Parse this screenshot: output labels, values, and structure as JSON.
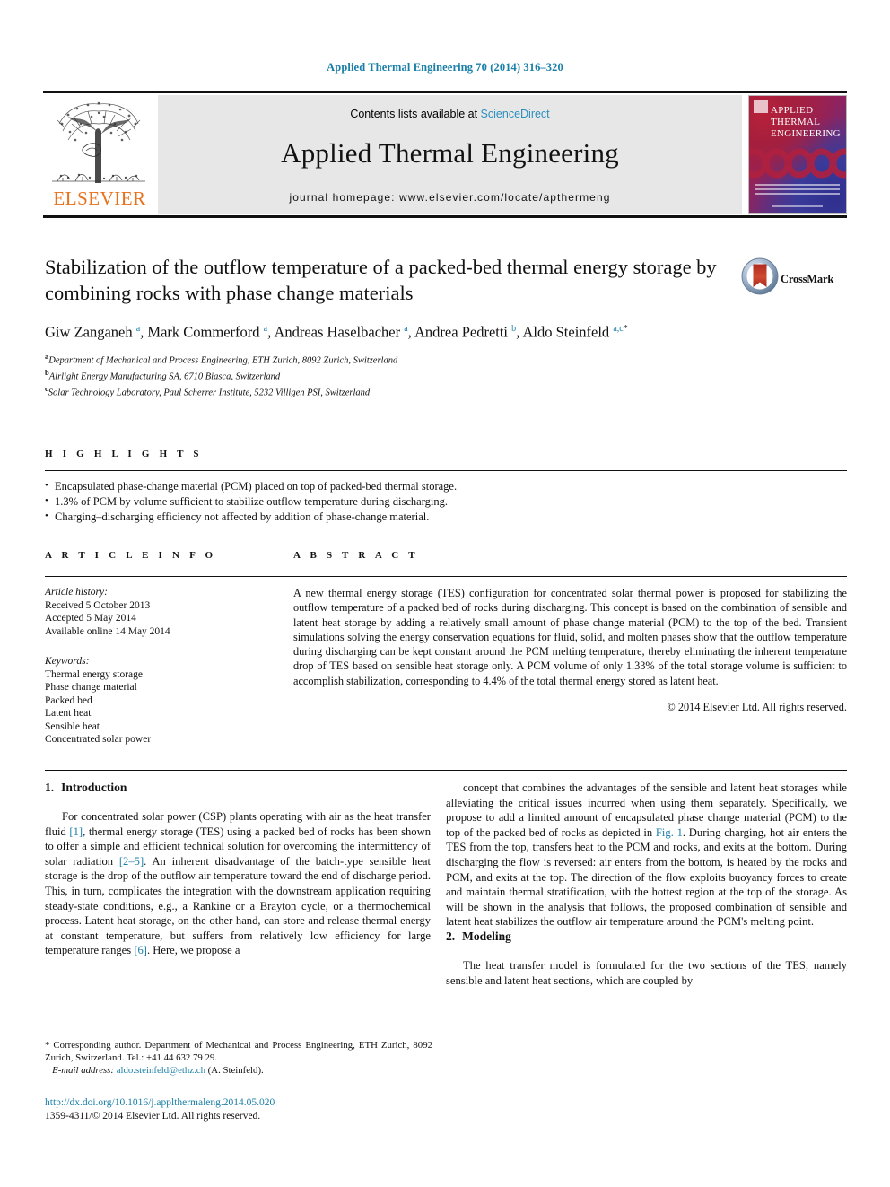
{
  "running_head": "Applied Thermal Engineering 70 (2014) 316–320",
  "masthead": {
    "publisher_name": "ELSEVIER",
    "contents_prefix": "Contents lists available at ",
    "contents_link": "ScienceDirect",
    "journal_title": "Applied Thermal Engineering",
    "homepage": "journal homepage: www.elsevier.com/locate/apthermeng",
    "cover_title": "APPLIED THERMAL ENGINEERING"
  },
  "crossmark": {
    "label": "CrossMark"
  },
  "article": {
    "title": "Stabilization of the outflow temperature of a packed-bed thermal energy storage by combining rocks with phase change materials",
    "authors_html": "Giw Zanganeh <sup>a</sup>, Mark Commerford <sup>a</sup>, Andreas Haselbacher <sup>a</sup>, Andrea Pedretti <sup>b</sup>, Aldo Steinfeld <sup>a,c</sup><sup class=\"star\">*</sup>",
    "affiliations": [
      {
        "marker": "a",
        "text": "Department of Mechanical and Process Engineering, ETH Zurich, 8092 Zurich, Switzerland"
      },
      {
        "marker": "b",
        "text": "Airlight Energy Manufacturing SA, 6710 Biasca, Switzerland"
      },
      {
        "marker": "c",
        "text": "Solar Technology Laboratory, Paul Scherrer Institute, 5232 Villigen PSI, Switzerland"
      }
    ]
  },
  "highlights": {
    "heading": "H I G H L I G H T S",
    "items": [
      "Encapsulated phase-change material (PCM) placed on top of packed-bed thermal storage.",
      "1.3% of PCM by volume sufficient to stabilize outflow temperature during discharging.",
      "Charging–discharging efficiency not affected by addition of phase-change material."
    ]
  },
  "article_info": {
    "heading": "A R T I C L E   I N F O",
    "history_label": "Article history:",
    "history": [
      "Received 5 October 2013",
      "Accepted 5 May 2014",
      "Available online 14 May 2014"
    ],
    "keywords_label": "Keywords:",
    "keywords": [
      "Thermal energy storage",
      "Phase change material",
      "Packed bed",
      "Latent heat",
      "Sensible heat",
      "Concentrated solar power"
    ]
  },
  "abstract": {
    "heading": "A B S T R A C T",
    "text": "A new thermal energy storage (TES) configuration for concentrated solar thermal power is proposed for stabilizing the outflow temperature of a packed bed of rocks during discharging. This concept is based on the combination of sensible and latent heat storage by adding a relatively small amount of phase change material (PCM) to the top of the bed. Transient simulations solving the energy conservation equations for fluid, solid, and molten phases show that the outflow temperature during discharging can be kept constant around the PCM melting temperature, thereby eliminating the inherent temperature drop of TES based on sensible heat storage only. A PCM volume of only 1.33% of the total storage volume is sufficient to accomplish stabilization, corresponding to 4.4% of the total thermal energy stored as latent heat.",
    "copyright": "© 2014 Elsevier Ltd. All rights reserved."
  },
  "body": {
    "section1": {
      "number": "1.",
      "title": "Introduction",
      "paragraph_html": "For concentrated solar power (CSP) plants operating with air as the heat transfer fluid <span class=\"ref\">[1]</span>, thermal energy storage (TES) using a packed bed of rocks has been shown to offer a simple and efficient technical solution for overcoming the intermittency of solar radiation <span class=\"ref\">[2–5]</span>. An inherent disadvantage of the batch-type sensible heat storage is the drop of the outflow air temperature toward the end of discharge period. This, in turn, complicates the integration with the downstream application requiring steady-state conditions, e.g., a Rankine or a Brayton cycle, or a thermochemical process. Latent heat storage, on the other hand, can store and release thermal energy at constant temperature, but suffers from relatively low efficiency for large temperature ranges <span class=\"ref\">[6]</span>. Here, we propose a"
    },
    "section1_cont": {
      "paragraph_html": "concept that combines the advantages of the sensible and latent heat storages while alleviating the critical issues incurred when using them separately. Specifically, we propose to add a limited amount of encapsulated phase change material (PCM) to the top of the packed bed of rocks as depicted in <span class=\"ref\">Fig. 1</span>. During charging, hot air enters the TES from the top, transfers heat to the PCM and rocks, and exits at the bottom. During discharging the flow is reversed: air enters from the bottom, is heated by the rocks and PCM, and exits at the top. The direction of the flow exploits buoyancy forces to create and maintain thermal stratification, with the hottest region at the top of the storage. As will be shown in the analysis that follows, the proposed combination of sensible and latent heat stabilizes the outflow air temperature around the PCM's melting point."
    },
    "section2": {
      "number": "2.",
      "title": "Modeling",
      "paragraph_html": "The heat transfer model is formulated for the two sections of the TES, namely sensible and latent heat sections, which are coupled by"
    }
  },
  "footnote": {
    "corresponding_html": "* Corresponding author. Department of Mechanical and Process Engineering, ETH Zurich, 8092 Zurich, Switzerland. Tel.: +41 44 632 79 29.",
    "email_label": "E-mail address:",
    "email": "aldo.steinfeld@ethz.ch",
    "email_suffix": "(A. Steinfeld)."
  },
  "doi_block": {
    "doi_url": "http://dx.doi.org/10.1016/j.applthermaleng.2014.05.020",
    "issn_line": "1359-4311/© 2014 Elsevier Ltd. All rights reserved."
  }
}
